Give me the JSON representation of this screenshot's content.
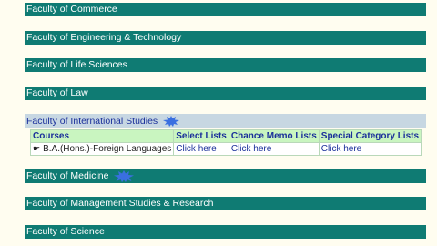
{
  "faculties": {
    "commerce": "Faculty of Commerce",
    "engineering": "Faculty of Engineering & Technology",
    "life_sciences": "Faculty of Life Sciences",
    "law": "Faculty of Law",
    "international": "Faculty of International Studies",
    "medicine": "Faculty of Medicine",
    "management": "Faculty of Management Studies & Research",
    "science": "Faculty of Science"
  },
  "colors": {
    "bar": "#0f7b73",
    "header_bg": "#c7d7e2",
    "table_header": "#c9f5c0",
    "badge": "#3a6fe0"
  },
  "badge_icon": "new-starburst-icon",
  "table": {
    "headers": [
      "Courses",
      "Select Lists",
      "Chance Memo Lists",
      "Special Category Lists"
    ],
    "rows": [
      {
        "course": "B.A.(Hons.)-Foreign Languages",
        "select": "Click here",
        "chance": "Click here",
        "special": "Click here"
      }
    ]
  }
}
